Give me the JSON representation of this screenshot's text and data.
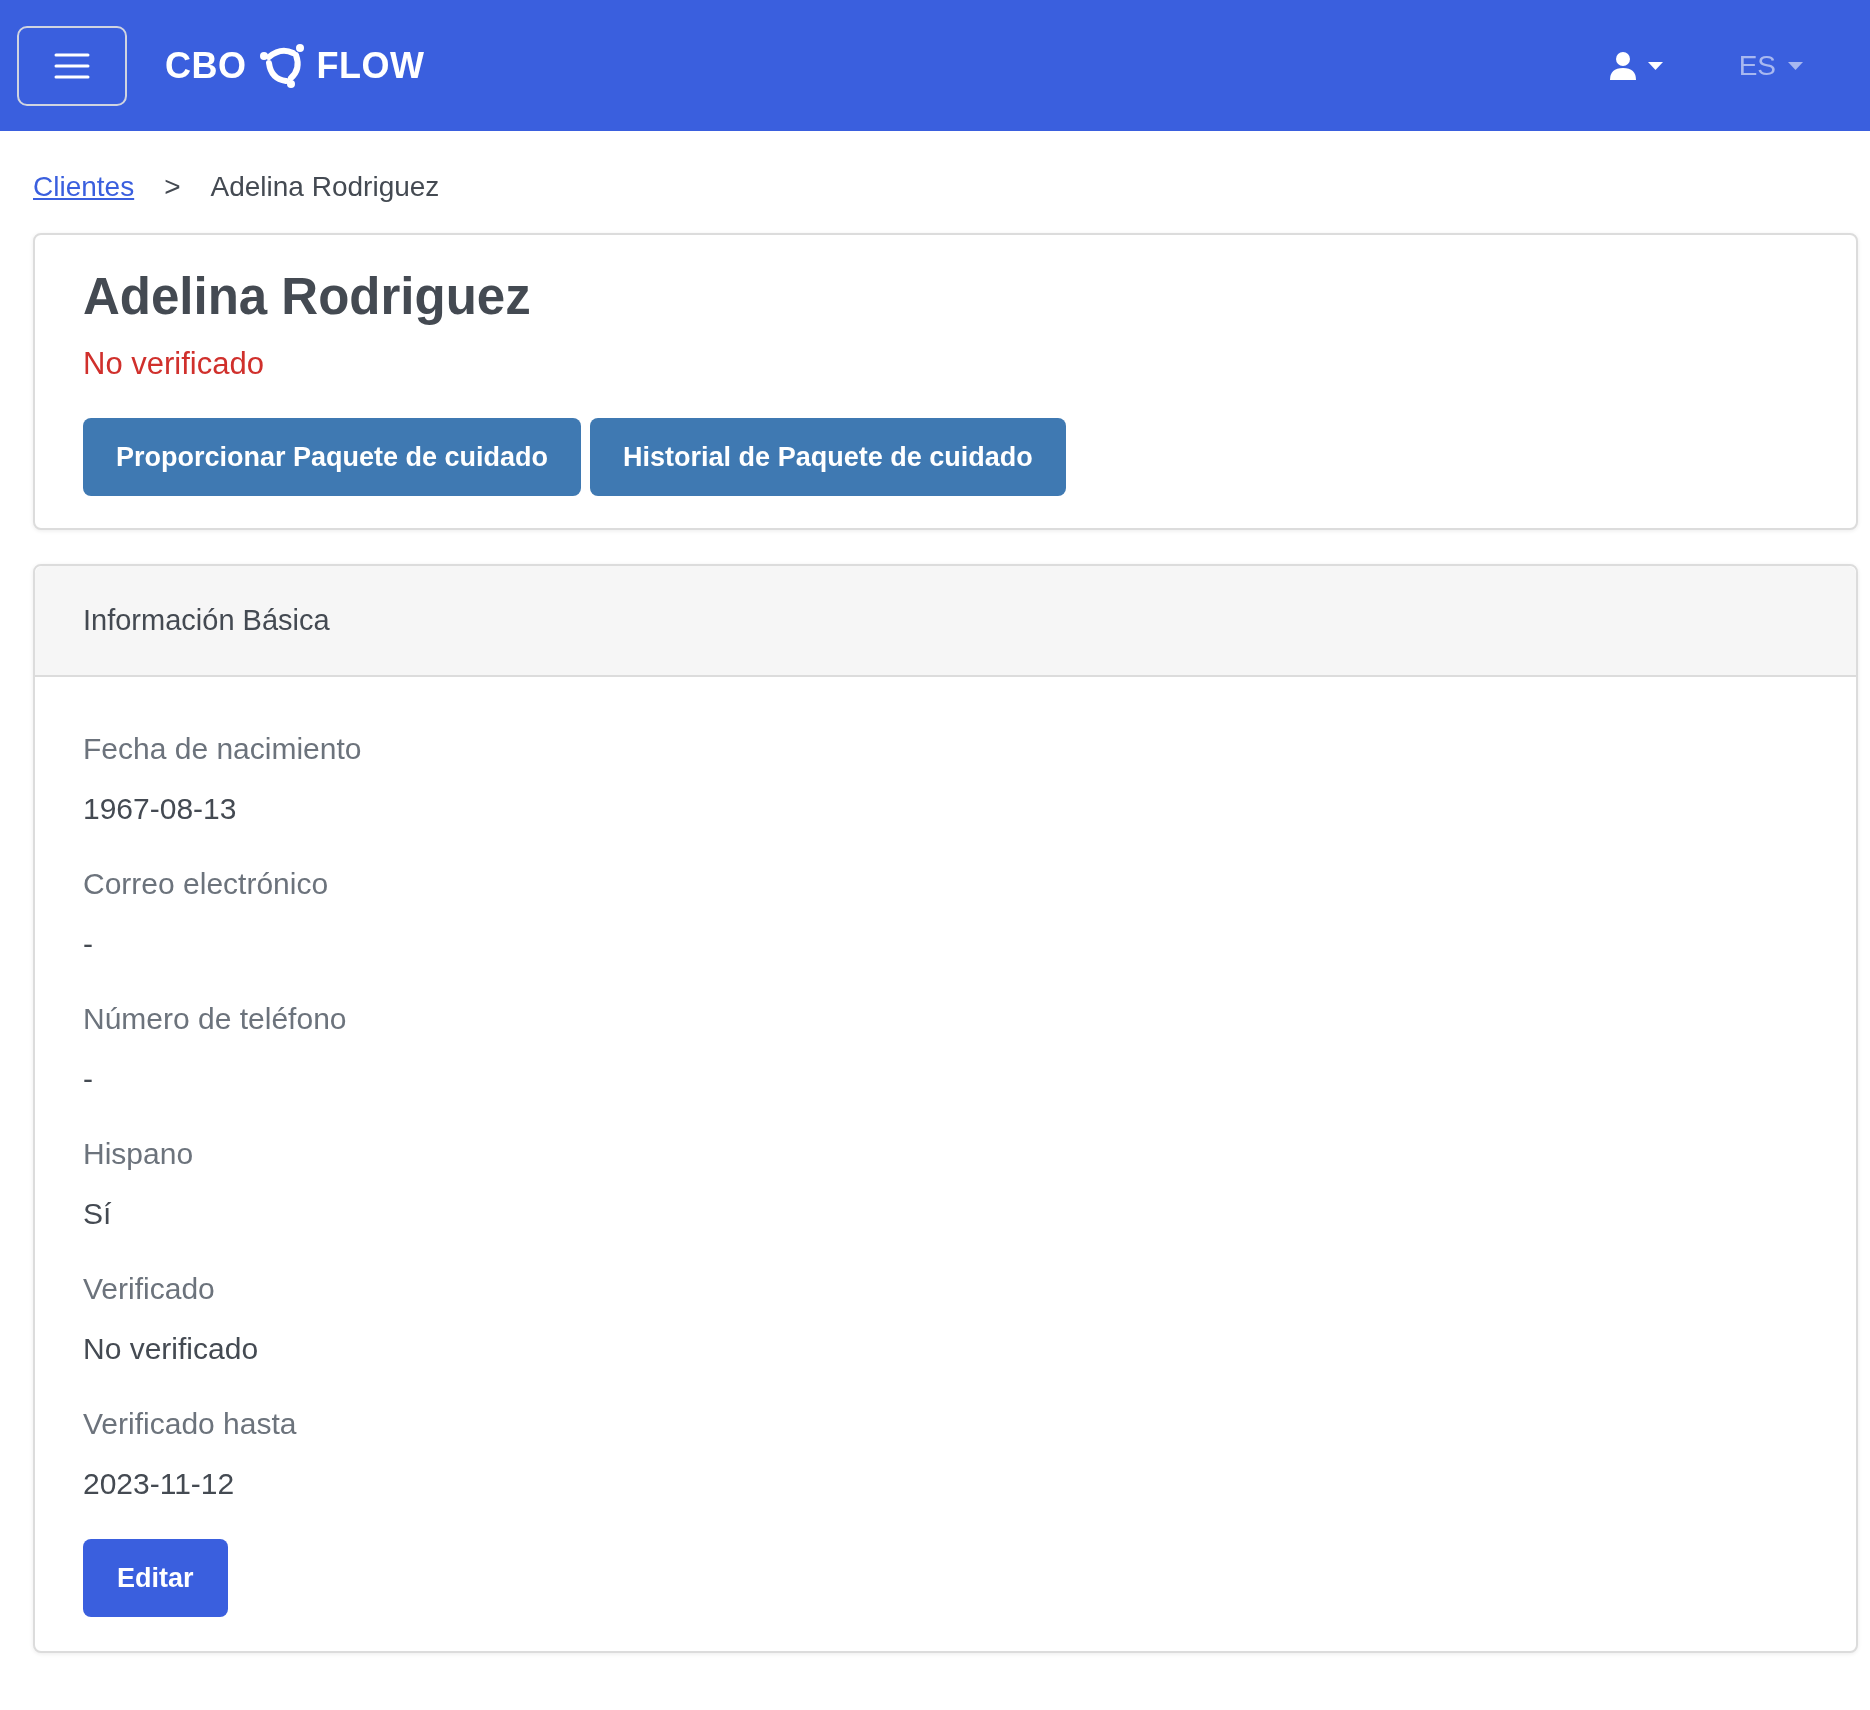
{
  "navbar": {
    "brand_left": "CBO",
    "brand_right": "FLOW",
    "language": "ES"
  },
  "breadcrumb": {
    "link": "Clientes",
    "separator": ">",
    "current": "Adelina Rodriguez"
  },
  "client": {
    "name": "Adelina Rodriguez",
    "status": {
      "text": "No verificado",
      "verified": false
    },
    "buttons": [
      "Proporcionar Paquete de cuidado",
      "Historial de Paquete de cuidado"
    ]
  },
  "basic_info": {
    "title": "Información Básica",
    "fields": [
      {
        "label": "Fecha de nacimiento",
        "value": "1967-08-13"
      },
      {
        "label": "Correo electrónico",
        "value": "-"
      },
      {
        "label": "Número de teléfono",
        "value": "-"
      },
      {
        "label": "Hispano",
        "value": "Sí"
      },
      {
        "label": "Verificado",
        "value": "No verificado"
      },
      {
        "label": "Verificado hasta",
        "value": "2023-11-12"
      }
    ],
    "edit_button": "Editar"
  }
}
